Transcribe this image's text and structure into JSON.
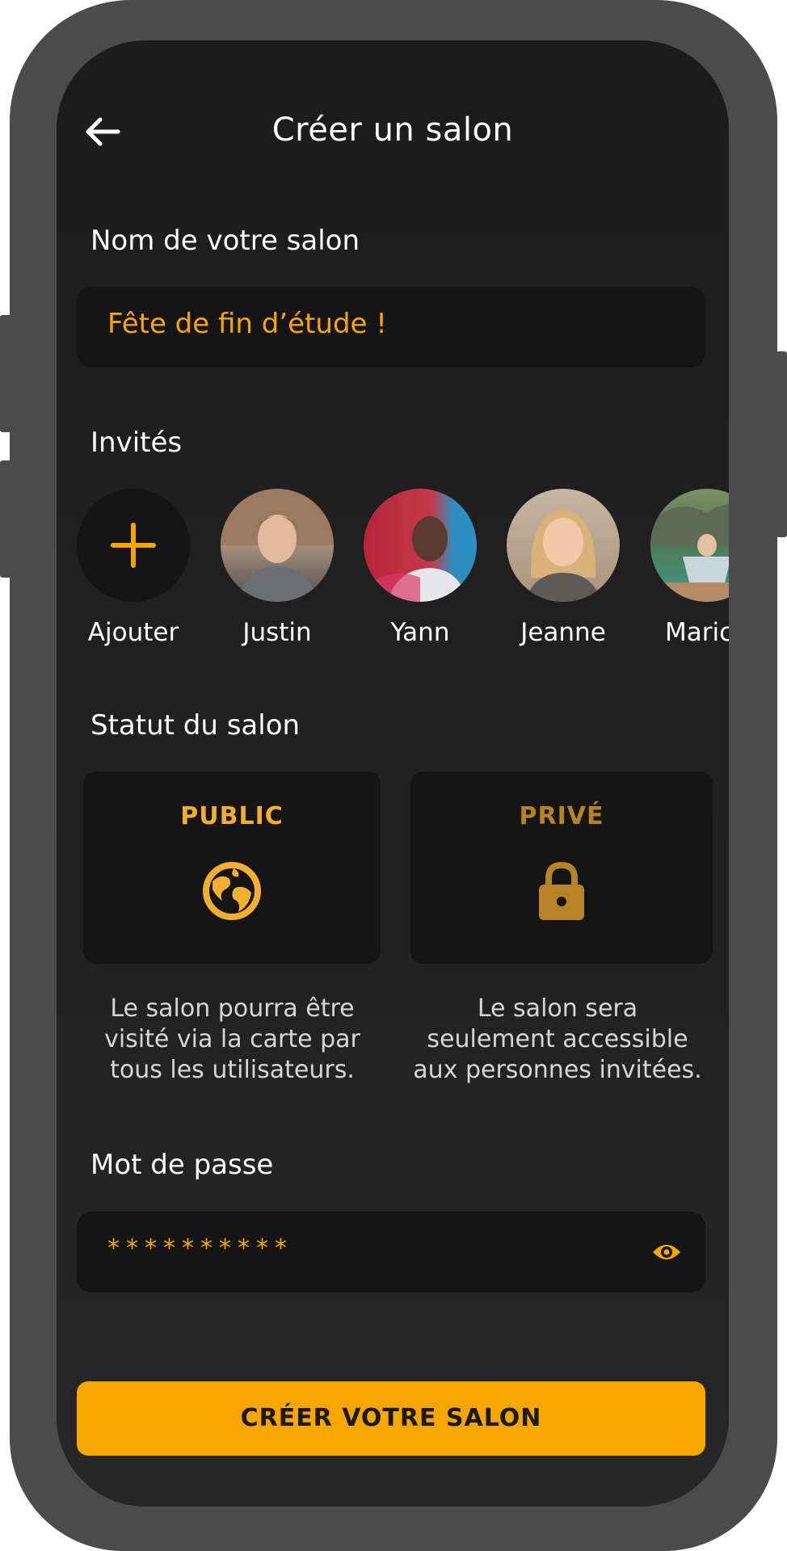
{
  "header": {
    "title": "Créer un salon",
    "back_icon": "arrow-left-icon"
  },
  "room_name": {
    "label": "Nom de votre salon",
    "value": "Fête de fin d’étude !"
  },
  "guests": {
    "label": "Invités",
    "add_label": "Ajouter",
    "list": [
      {
        "name": "Justin"
      },
      {
        "name": "Yann"
      },
      {
        "name": "Jeanne"
      },
      {
        "name": "Maric"
      }
    ]
  },
  "status": {
    "label": "Statut du salon",
    "public": {
      "title": "PUBLIC",
      "icon": "globe-icon",
      "desc_lines": [
        "Le salon pourra être",
        "visité via la carte par",
        "tous les utilisateurs."
      ]
    },
    "private": {
      "title": "PRIVÉ",
      "icon": "lock-icon",
      "desc_lines": [
        "Le salon sera",
        "seulement accessible",
        "aux personnes invitées."
      ]
    }
  },
  "password": {
    "label": "Mot de passe",
    "value": "**********",
    "toggle_icon": "eye-icon"
  },
  "cta": {
    "label": "CRÉER VOTRE SALON"
  },
  "colors": {
    "accent": "#f7a600",
    "background": "#1f1f1f",
    "card": "#151515"
  }
}
